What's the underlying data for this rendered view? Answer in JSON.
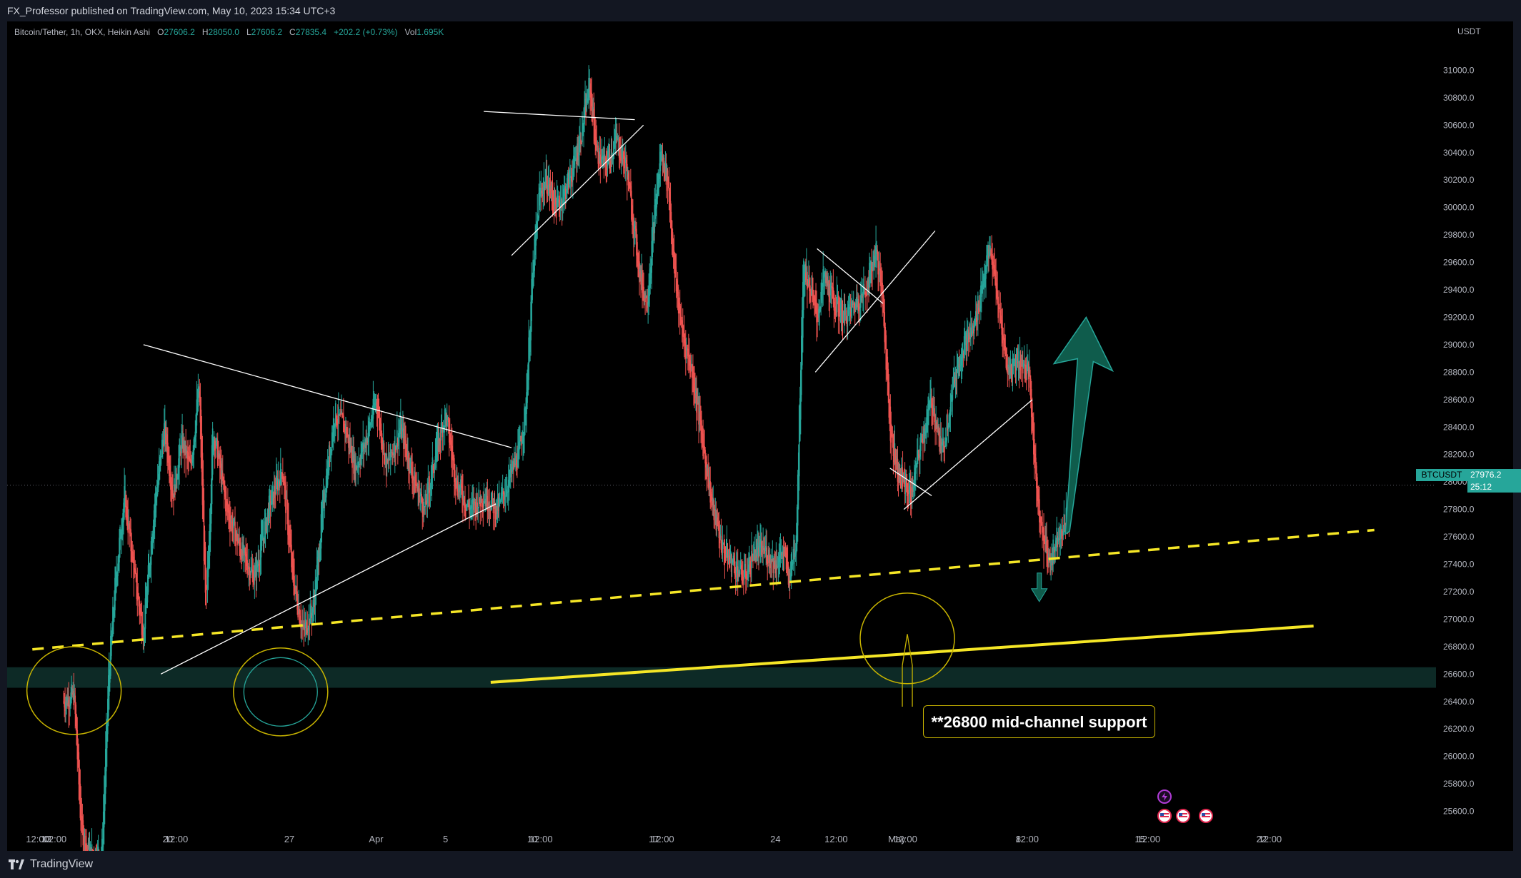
{
  "header": {
    "publisher_line": "FX_Professor published on TradingView.com, May 10, 2023 15:34 UTC+3"
  },
  "legend": {
    "symbol": "Bitcoin/Tether, 1h, OKX, Heikin Ashi",
    "o_label": "O",
    "o_value": "27606.2",
    "h_label": "H",
    "h_value": "28050.0",
    "l_label": "L",
    "l_value": "27606.2",
    "c_label": "C",
    "c_value": "27835.4",
    "change": "+202.2 (+0.73%)",
    "vol_label": "Vol",
    "vol_value": "1.695K"
  },
  "price_tag": {
    "ticker": "BTCUSDT",
    "last": "27976.2",
    "countdown": "25:12"
  },
  "callout": {
    "text": "**26800 mid-channel support"
  },
  "footer": {
    "brand": "TradingView"
  },
  "colors": {
    "up": "#26a69a",
    "down": "#ef5350",
    "support_line": "#f5e626",
    "circle": "#c8b400",
    "arrow": "#0f5c4c",
    "zone": "#0d2a26"
  },
  "chart_data": {
    "type": "candlestick",
    "axis_unit": "USDT",
    "ylim": [
      25400,
      31200
    ],
    "y_ticks": [
      25600,
      25800,
      26000,
      26200,
      26400,
      26600,
      26800,
      27000,
      27200,
      27400,
      27600,
      27800,
      28000,
      28200,
      28400,
      28600,
      28800,
      29000,
      29200,
      29400,
      29600,
      29800,
      30000,
      30200,
      30400,
      30600,
      30800,
      31000
    ],
    "y_tick_labels": [
      "25600.0",
      "25800.0",
      "26000.0",
      "26200.0",
      "26400.0",
      "26600.0",
      "26800.0",
      "27000.0",
      "27200.0",
      "27400.0",
      "27600.0",
      "27800.0",
      "28000.0",
      "28200.0",
      "28400.0",
      "28600.0",
      "28800.0",
      "29000.0",
      "29200.0",
      "29400.0",
      "29600.0",
      "29800.0",
      "30000.0",
      "30200.0",
      "30400.0",
      "30600.0",
      "30800.0",
      "31000.0"
    ],
    "x_tick_labels": [
      "12:00",
      "13",
      "12:00",
      "20",
      "12:00",
      "27",
      "Apr",
      "5",
      "10",
      "12:00",
      "17",
      "12:00",
      "24",
      "12:00",
      "May",
      "12:00",
      "8",
      "12:00",
      "15",
      "12:00",
      "22",
      "12:00"
    ],
    "x_tick_day_index": [
      -1.5,
      -1,
      -0.5,
      6,
      6.5,
      13,
      18,
      22,
      27,
      27.5,
      34,
      34.5,
      41,
      44.5,
      48,
      48.5,
      55,
      55.5,
      62,
      62.5,
      69,
      69.5
    ],
    "start_date": "2023-03-12",
    "price_path": [
      [
        0,
        26400
      ],
      [
        0.6,
        26450
      ],
      [
        1.0,
        25500
      ],
      [
        1.4,
        25300
      ],
      [
        2.2,
        25300
      ],
      [
        2.6,
        26600
      ],
      [
        3.0,
        27300
      ],
      [
        3.5,
        27900
      ],
      [
        4.2,
        27200
      ],
      [
        4.6,
        26900
      ],
      [
        5.2,
        27800
      ],
      [
        5.8,
        28400
      ],
      [
        6.3,
        27900
      ],
      [
        6.8,
        28300
      ],
      [
        7.3,
        28100
      ],
      [
        7.8,
        28700
      ],
      [
        8.2,
        27000
      ],
      [
        8.6,
        28400
      ],
      [
        9.4,
        27800
      ],
      [
        10.2,
        27500
      ],
      [
        11.0,
        27300
      ],
      [
        11.8,
        27800
      ],
      [
        12.6,
        28100
      ],
      [
        13.2,
        27300
      ],
      [
        13.8,
        26900
      ],
      [
        14.4,
        27100
      ],
      [
        15.0,
        27900
      ],
      [
        15.6,
        28500
      ],
      [
        16.2,
        28400
      ],
      [
        16.8,
        28100
      ],
      [
        17.4,
        28300
      ],
      [
        18.0,
        28600
      ],
      [
        18.6,
        28100
      ],
      [
        19.4,
        28400
      ],
      [
        20.2,
        28000
      ],
      [
        20.8,
        27800
      ],
      [
        21.4,
        28200
      ],
      [
        22.0,
        28500
      ],
      [
        22.6,
        28000
      ],
      [
        23.4,
        27800
      ],
      [
        24.2,
        27900
      ],
      [
        25.0,
        27800
      ],
      [
        25.6,
        28000
      ],
      [
        26.2,
        28200
      ],
      [
        26.6,
        28500
      ],
      [
        27.0,
        29500
      ],
      [
        27.4,
        30100
      ],
      [
        27.8,
        30200
      ],
      [
        28.4,
        30000
      ],
      [
        28.8,
        30100
      ],
      [
        29.4,
        30300
      ],
      [
        29.9,
        30600
      ],
      [
        30.3,
        30900
      ],
      [
        30.7,
        30400
      ],
      [
        31.2,
        30300
      ],
      [
        31.8,
        30500
      ],
      [
        32.4,
        30300
      ],
      [
        32.8,
        29900
      ],
      [
        33.2,
        29500
      ],
      [
        33.6,
        29300
      ],
      [
        34.0,
        29900
      ],
      [
        34.4,
        30400
      ],
      [
        34.8,
        30200
      ],
      [
        35.2,
        29500
      ],
      [
        35.6,
        29100
      ],
      [
        36.2,
        28800
      ],
      [
        36.8,
        28300
      ],
      [
        37.4,
        27800
      ],
      [
        38.0,
        27500
      ],
      [
        38.6,
        27400
      ],
      [
        39.2,
        27300
      ],
      [
        39.8,
        27500
      ],
      [
        40.4,
        27500
      ],
      [
        41.0,
        27400
      ],
      [
        41.4,
        27500
      ],
      [
        41.8,
        27300
      ],
      [
        42.2,
        27600
      ],
      [
        42.6,
        29600
      ],
      [
        43.0,
        29400
      ],
      [
        43.4,
        29200
      ],
      [
        43.8,
        29500
      ],
      [
        44.4,
        29300
      ],
      [
        45.0,
        29200
      ],
      [
        45.6,
        29300
      ],
      [
        46.2,
        29400
      ],
      [
        46.8,
        29700
      ],
      [
        47.2,
        29300
      ],
      [
        47.6,
        28400
      ],
      [
        48.0,
        28100
      ],
      [
        48.4,
        28000
      ],
      [
        48.8,
        27900
      ],
      [
        49.4,
        28300
      ],
      [
        50.0,
        28600
      ],
      [
        50.6,
        28200
      ],
      [
        51.2,
        28700
      ],
      [
        51.8,
        29000
      ],
      [
        52.4,
        29100
      ],
      [
        53.0,
        29500
      ],
      [
        53.4,
        29700
      ],
      [
        53.8,
        29300
      ],
      [
        54.4,
        28800
      ],
      [
        55.0,
        28900
      ],
      [
        55.6,
        28800
      ],
      [
        56.0,
        28000
      ],
      [
        56.4,
        27600
      ],
      [
        56.8,
        27400
      ],
      [
        57.2,
        27600
      ],
      [
        57.6,
        27700
      ],
      [
        58.0,
        27800
      ]
    ],
    "horizontal_zone": [
      26500,
      26650
    ],
    "dashed_support": {
      "from": [
        -1.8,
        26780
      ],
      "to": [
        75.5,
        27650
      ]
    },
    "solid_support": {
      "from": [
        24.6,
        26540
      ],
      "to": [
        72.0,
        26950
      ]
    },
    "trendlines": [
      {
        "from": [
          4.6,
          29000
        ],
        "to": [
          25.8,
          28250
        ]
      },
      {
        "from": [
          5.6,
          26600
        ],
        "to": [
          24.9,
          27840
        ]
      },
      {
        "from": [
          24.2,
          30700
        ],
        "to": [
          32.9,
          30640
        ]
      },
      {
        "from": [
          25.8,
          29650
        ],
        "to": [
          33.4,
          30600
        ]
      },
      {
        "from": [
          43.4,
          29700
        ],
        "to": [
          47.2,
          29300
        ]
      },
      {
        "from": [
          43.3,
          28800
        ],
        "to": [
          50.2,
          29830
        ]
      },
      {
        "from": [
          47.6,
          28100
        ],
        "to": [
          50.0,
          27900
        ]
      },
      {
        "from": [
          48.4,
          27800
        ],
        "to": [
          55.8,
          28600
        ]
      }
    ],
    "circles": [
      {
        "center": [
          0.6,
          26480
        ],
        "r_days": 1.5,
        "r_price": 320
      },
      {
        "center": [
          12.5,
          26470
        ],
        "r_days": 1.5,
        "r_price": 320
      },
      {
        "center": [
          48.6,
          26860
        ],
        "r_days": 1.5,
        "r_price": 330
      }
    ],
    "up_arrow": {
      "base": [
        57.7,
        27620
      ],
      "tip": [
        58.9,
        29200
      ]
    },
    "down_arrow": {
      "at": [
        56.2,
        27180
      ]
    }
  }
}
